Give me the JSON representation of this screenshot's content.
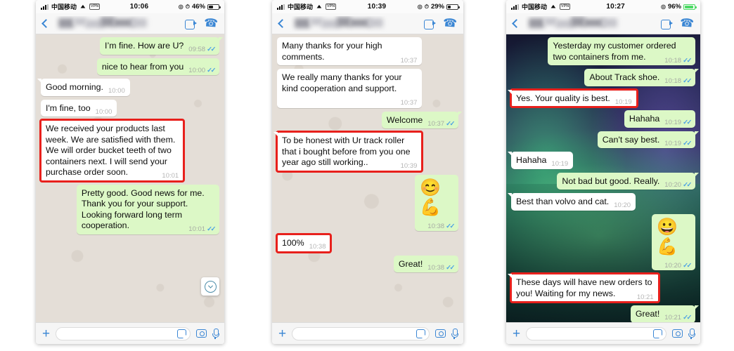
{
  "app": "WhatsApp",
  "icons": {
    "back": "chevron-left-icon",
    "video": "video-call-icon",
    "call": "phone-call-icon",
    "plus": "plus-icon",
    "sticker": "sticker-icon",
    "camera": "camera-icon",
    "mic": "microphone-icon",
    "scroll_down": "chevron-down-circle-icon",
    "wifi": "wifi-icon",
    "signal": "signal-bars-icon",
    "vpn": "vpn-badge-icon",
    "alarm": "alarm-clock-icon",
    "location": "location-services-icon",
    "battery": "battery-icon"
  },
  "colors": {
    "outgoing_bubble": "#dcf8c6",
    "incoming_bubble": "#ffffff",
    "accent_blue": "#3a86d4",
    "tick_blue": "#4fa3e3",
    "highlight_red": "#e8201c",
    "chat_bg": "#e4ded7",
    "charging_green": "#4cd964"
  },
  "input_bar": {
    "placeholder": ""
  },
  "phones": [
    {
      "id": "phone-1",
      "status": {
        "carrier": "中国移动",
        "vpn": "VPN",
        "time": "10:06",
        "battery_percent": "46%",
        "battery_level": 46,
        "charging": false,
        "indicators": [
          "location-services-icon",
          "alarm-clock-icon"
        ]
      },
      "background": "doodle",
      "scroll_down_button": true,
      "messages": [
        {
          "dir": "out",
          "text": "I’m fine. How are U?",
          "time": "09:58",
          "ticks": true,
          "tail": true,
          "highlight": false
        },
        {
          "dir": "out",
          "text": "nice to hear from you",
          "time": "10:00",
          "ticks": true,
          "tail": false,
          "highlight": false
        },
        {
          "dir": "in",
          "text": "Good morning.",
          "time": "10:00",
          "ticks": false,
          "tail": true,
          "highlight": false
        },
        {
          "dir": "in",
          "text": "I'm fine, too",
          "time": "10:00",
          "ticks": false,
          "tail": false,
          "highlight": false
        },
        {
          "dir": "in",
          "text": "We received your products last week. We are satisfied with them. We will order bucket teeth of two containers next. I will send your purchase order soon.",
          "time": "10:01",
          "ticks": false,
          "tail": false,
          "highlight": true
        },
        {
          "dir": "out",
          "text": "Pretty good. Good news for me. Thank you for your support. Looking forward long term cooperation.",
          "time": "10:01",
          "ticks": true,
          "tail": false,
          "highlight": false
        }
      ]
    },
    {
      "id": "phone-2",
      "status": {
        "carrier": "中国移动",
        "vpn": "VPN",
        "time": "10:39",
        "battery_percent": "29%",
        "battery_level": 29,
        "charging": false,
        "indicators": [
          "location-services-icon",
          "alarm-clock-icon"
        ]
      },
      "background": "doodle",
      "scroll_down_button": false,
      "messages": [
        {
          "dir": "in",
          "text": "Many thanks for your high comments.",
          "time": "10:37",
          "ticks": false,
          "tail": false,
          "highlight": false
        },
        {
          "dir": "in",
          "text": "We really many thanks for your kind cooperation and support.",
          "time": "10:37",
          "ticks": false,
          "tail": false,
          "highlight": false
        },
        {
          "dir": "out",
          "text": "Welcome",
          "time": "10:37",
          "ticks": true,
          "tail": true,
          "highlight": false
        },
        {
          "dir": "in",
          "text": "To be honest with Ur track roller that i bought before from you one year ago still working..",
          "time": "10:39",
          "ticks": false,
          "tail": true,
          "highlight": true
        },
        {
          "dir": "out",
          "emoji": "😊💪",
          "text": "",
          "time": "10:38",
          "ticks": true,
          "tail": false,
          "highlight": false
        },
        {
          "dir": "in",
          "text": "100%",
          "time": "10:38",
          "ticks": false,
          "tail": false,
          "highlight": true
        },
        {
          "dir": "out",
          "text": "Great!",
          "time": "10:38",
          "ticks": true,
          "tail": false,
          "highlight": false
        }
      ]
    },
    {
      "id": "phone-3",
      "status": {
        "carrier": "中国移动",
        "vpn": "VPN",
        "time": "10:27",
        "battery_percent": "96%",
        "battery_level": 96,
        "charging": true,
        "indicators": [
          "location-services-icon"
        ]
      },
      "background": "aurora",
      "scroll_down_button": false,
      "messages": [
        {
          "dir": "out",
          "text": "Yesterday my customer ordered two containers from me.",
          "time": "10:18",
          "ticks": true,
          "tail": false,
          "highlight": false
        },
        {
          "dir": "out",
          "text": "About Track shoe.",
          "time": "10:18",
          "ticks": true,
          "tail": true,
          "highlight": false
        },
        {
          "dir": "in",
          "text": "Yes. Your quality is best.",
          "time": "10:19",
          "ticks": false,
          "tail": true,
          "highlight": true
        },
        {
          "dir": "out",
          "text": "Hahaha",
          "time": "10:19",
          "ticks": true,
          "tail": false,
          "highlight": false
        },
        {
          "dir": "out",
          "text": "Can't say best.",
          "time": "10:19",
          "ticks": true,
          "tail": true,
          "highlight": false
        },
        {
          "dir": "in",
          "text": "Hahaha",
          "time": "10:19",
          "ticks": false,
          "tail": true,
          "highlight": false
        },
        {
          "dir": "out",
          "text": "Not bad but good. Really.",
          "time": "10:20",
          "ticks": true,
          "tail": true,
          "highlight": false
        },
        {
          "dir": "in",
          "text": "Best than volvo and cat.",
          "time": "10:20",
          "ticks": false,
          "tail": true,
          "highlight": false
        },
        {
          "dir": "out",
          "emoji": "😀💪",
          "text": "",
          "time": "10:20",
          "ticks": true,
          "tail": false,
          "highlight": false
        },
        {
          "dir": "in",
          "text": "These days will have new orders to you! Waiting for my news.",
          "time": "10:21",
          "ticks": false,
          "tail": true,
          "highlight": true
        },
        {
          "dir": "out",
          "text": "Great!",
          "time": "10:21",
          "ticks": true,
          "tail": true,
          "highlight": false
        }
      ]
    }
  ]
}
